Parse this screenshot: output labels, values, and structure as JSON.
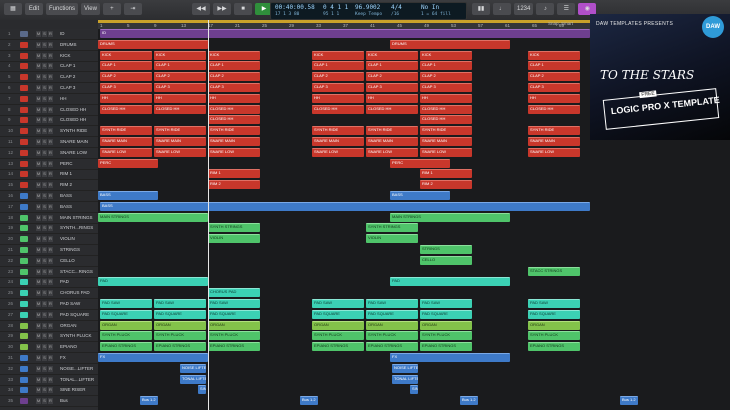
{
  "toolbar": {
    "left_buttons": [
      "Edit",
      "Functions",
      "View"
    ],
    "lcd": {
      "time": "00:40:00.58",
      "bars": "17 1 3 80",
      "beats": "0 4 1 1",
      "beats2": "95 1 1",
      "tempo": "96.9002",
      "keep_tempo": "Keep Tempo",
      "sig": "4/4",
      "sig_div": "/16",
      "key": "No In",
      "key2": "1 = 64 fill"
    },
    "snap_label": "Snap:",
    "snap_value": "Smart"
  },
  "ruler": {
    "ticks": [
      "1",
      "5",
      "9",
      "13",
      "17",
      "21",
      "25",
      "29",
      "33",
      "37",
      "41",
      "45",
      "49",
      "53",
      "57",
      "61",
      "65",
      "69"
    ]
  },
  "tracks": [
    {
      "num": "1",
      "name": "ID"
    },
    {
      "num": "2",
      "name": "DRUMS"
    },
    {
      "num": "3",
      "name": "KICK"
    },
    {
      "num": "4",
      "name": "CLAP 1"
    },
    {
      "num": "5",
      "name": "CLAP 2"
    },
    {
      "num": "6",
      "name": "CLAP 3"
    },
    {
      "num": "7",
      "name": "HH"
    },
    {
      "num": "8",
      "name": "CLOSED HH"
    },
    {
      "num": "9",
      "name": "CLOSED HH"
    },
    {
      "num": "10",
      "name": "SYNTH RIDE"
    },
    {
      "num": "11",
      "name": "SNARE MAIN"
    },
    {
      "num": "12",
      "name": "SNARE LOW"
    },
    {
      "num": "13",
      "name": "PERC"
    },
    {
      "num": "14",
      "name": "RIM 1"
    },
    {
      "num": "15",
      "name": "RIM 2"
    },
    {
      "num": "16",
      "name": "BASS"
    },
    {
      "num": "17",
      "name": "BASS"
    },
    {
      "num": "18",
      "name": "MAIN STRINGS"
    },
    {
      "num": "19",
      "name": "SYNTH...RINGS"
    },
    {
      "num": "20",
      "name": "VIOLIN"
    },
    {
      "num": "21",
      "name": "STRINGS"
    },
    {
      "num": "22",
      "name": "CELLO"
    },
    {
      "num": "23",
      "name": "STACC...RINGS"
    },
    {
      "num": "24",
      "name": "PAD"
    },
    {
      "num": "25",
      "name": "CHORUS PAD"
    },
    {
      "num": "26",
      "name": "PAD SAW"
    },
    {
      "num": "27",
      "name": "PAD SQUARE"
    },
    {
      "num": "28",
      "name": "ORGAN"
    },
    {
      "num": "29",
      "name": "SYNTH PLUCK"
    },
    {
      "num": "30",
      "name": "EPIANO"
    },
    {
      "num": "31",
      "name": "FX"
    },
    {
      "num": "32",
      "name": "NOISE...LIFTER"
    },
    {
      "num": "33",
      "name": "TONAL...LIFTER"
    },
    {
      "num": "34",
      "name": "SINE RISER"
    },
    {
      "num": "35",
      "name": "Bus"
    }
  ],
  "regions": {
    "section_labels": [
      "ID",
      "DRUMS",
      "DRUMS",
      "PERC",
      "PERC",
      "BASS",
      "BASS",
      "BASS",
      "MAIN STRINGS",
      "MAIN STRINGS",
      "PAD",
      "PAD",
      "FX",
      "FX"
    ],
    "drum_labels": [
      "KICK",
      "CLAP 1",
      "CLAP 2",
      "CLAP 3",
      "HH",
      "CLOSED HH",
      "SYNTH RIDE",
      "SNARE MAIN",
      "SNARE LOW",
      "RIM 1",
      "RIM 2"
    ],
    "strings_labels": [
      "SYNTH STRINGS",
      "VIOLIN",
      "STRINGS",
      "CELLO",
      "STACC STRINGS"
    ],
    "pad_labels": [
      "CHORUS PAD",
      "PAD SAW",
      "PAD SQUARE",
      "ORGAN",
      "SYNTH PLUCK",
      "EPIANO STRINGS"
    ],
    "fx_labels": [
      "NOISE LIFTER",
      "TONAL LIFTER",
      "SINE RISER"
    ],
    "bus_labels": [
      "Bus 1.2",
      "Bus 1.2",
      "Bus 1.2",
      "Bus 1.2"
    ]
  },
  "cover": {
    "brand": "DAW TEMPLATES PRESENTS",
    "logo": "DAW",
    "title": "TO THE STARS",
    "tag": "FREE",
    "product": "LOGIC PRO X TEMPLATE"
  }
}
